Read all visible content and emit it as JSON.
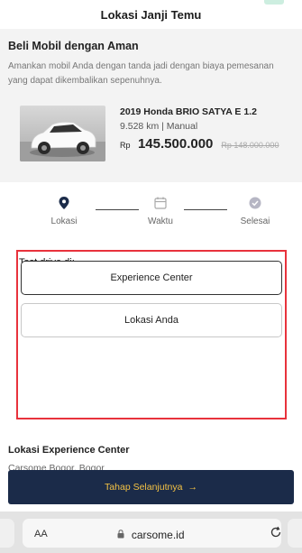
{
  "header": {
    "title": "Lokasi Janji Temu"
  },
  "promo": {
    "heading": "Beli Mobil dengan Aman",
    "description": "Amankan mobil Anda dengan tanda jadi dengan biaya pemesanan yang dapat dikembalikan sepenuhnya."
  },
  "car": {
    "name": "2019 Honda BRIO SATYA E 1.2",
    "meta": "9.528 km  |  Manual",
    "price_prefix": "Rp",
    "price": "145.500.000",
    "price_old": "Rp 148.000.000"
  },
  "steps": [
    {
      "label": "Lokasi",
      "icon": "location-pin-icon"
    },
    {
      "label": "Waktu",
      "icon": "calendar-icon"
    },
    {
      "label": "Selesai",
      "icon": "check-circle-icon"
    }
  ],
  "test_drive": {
    "title": "Test drive di:",
    "options": [
      "Experience Center",
      "Lokasi Anda"
    ]
  },
  "location": {
    "title": "Lokasi Experience Center",
    "value": "Carsome Bogor, Bogor"
  },
  "next_button": {
    "label": "Tahap Selanjutnya",
    "arrow": "→"
  },
  "browser": {
    "text_size": "AA",
    "url": "carsome.id"
  },
  "colors": {
    "primary_button": "#1b2b49",
    "button_text": "#f4c244",
    "highlight_border": "#e8323c"
  }
}
